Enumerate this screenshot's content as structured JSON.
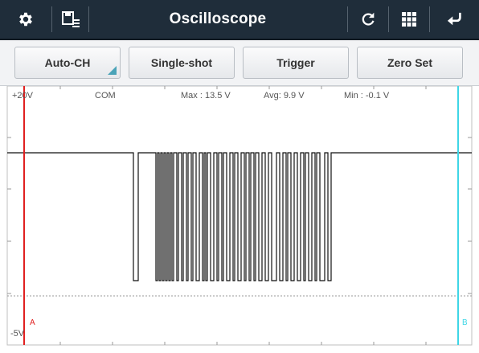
{
  "titlebar": {
    "title": "Oscilloscope",
    "icons": [
      "gear-icon",
      "save-list-icon",
      "refresh-icon",
      "grid-icon",
      "back-icon"
    ]
  },
  "toolbar": {
    "buttons": [
      {
        "label": "Auto-CH"
      },
      {
        "label": "Single-shot"
      },
      {
        "label": "Trigger"
      },
      {
        "label": "Zero Set"
      }
    ]
  },
  "scope": {
    "top_label": "+20V",
    "bottom_label": "-5V",
    "com_label": "COM",
    "max_label": "Max : 13.5 V",
    "avg_label": "Avg: 9.9 V",
    "min_label": "Min : -0.1 V",
    "cursor_a_label": "A",
    "cursor_b_label": "B",
    "colors": {
      "trace": "#111111",
      "cursor_a": "#e02020",
      "cursor_b": "#3fd6e6",
      "grid": "#9a9a9a"
    }
  }
}
